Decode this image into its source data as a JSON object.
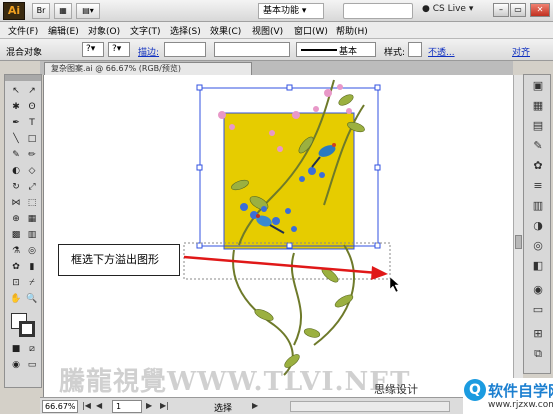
{
  "app": {
    "logo": "Ai",
    "workspace": "基本功能",
    "cs_live": "CS Live",
    "window_controls": [
      "minimize",
      "restore",
      "close"
    ]
  },
  "menu": [
    "文件(F)",
    "编辑(E)",
    "对象(O)",
    "文字(T)",
    "选择(S)",
    "效果(C)",
    "视图(V)",
    "窗口(W)",
    "帮助(H)"
  ],
  "control_bar": {
    "selection": "混合对象",
    "stroke_label": "描边:",
    "stroke_style": "基本",
    "style_label": "样式:",
    "opacity_link": "不透...",
    "align_link": "对齐"
  },
  "document_tab": {
    "title": "复杂图案.ai @ 66.67% (RGB/预览)"
  },
  "canvas": {
    "callout": "框选下方溢出图形",
    "watermark": "騰龍視覺WWW.TLVI.NET",
    "credit": "思缘设计"
  },
  "colors": {
    "square_fill": "#e6cc00",
    "arrow": "#e01818",
    "selection": "#3050e0"
  },
  "site_logo": {
    "name": "软件自学网",
    "url": "www.rjzxw.com"
  },
  "status_bar": {
    "zoom": "66.67%",
    "page": "1",
    "status": "选择"
  }
}
